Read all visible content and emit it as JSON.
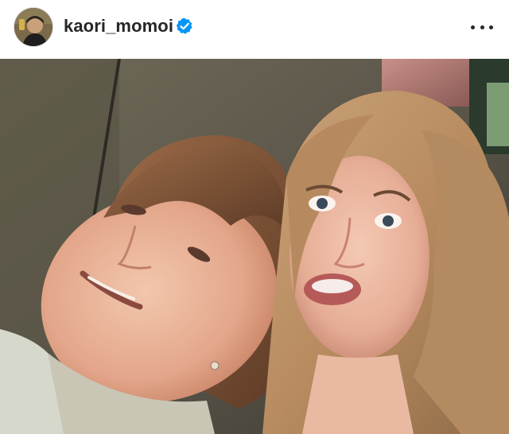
{
  "post": {
    "username": "kaori_momoi",
    "verified": true,
    "avatar_icon": "profile-avatar",
    "more_icon": "more-options-icon",
    "photo_description_icon": "post-photo"
  },
  "colors": {
    "text": "#262626",
    "verified_badge": "#0095f6",
    "background": "#ffffff"
  }
}
